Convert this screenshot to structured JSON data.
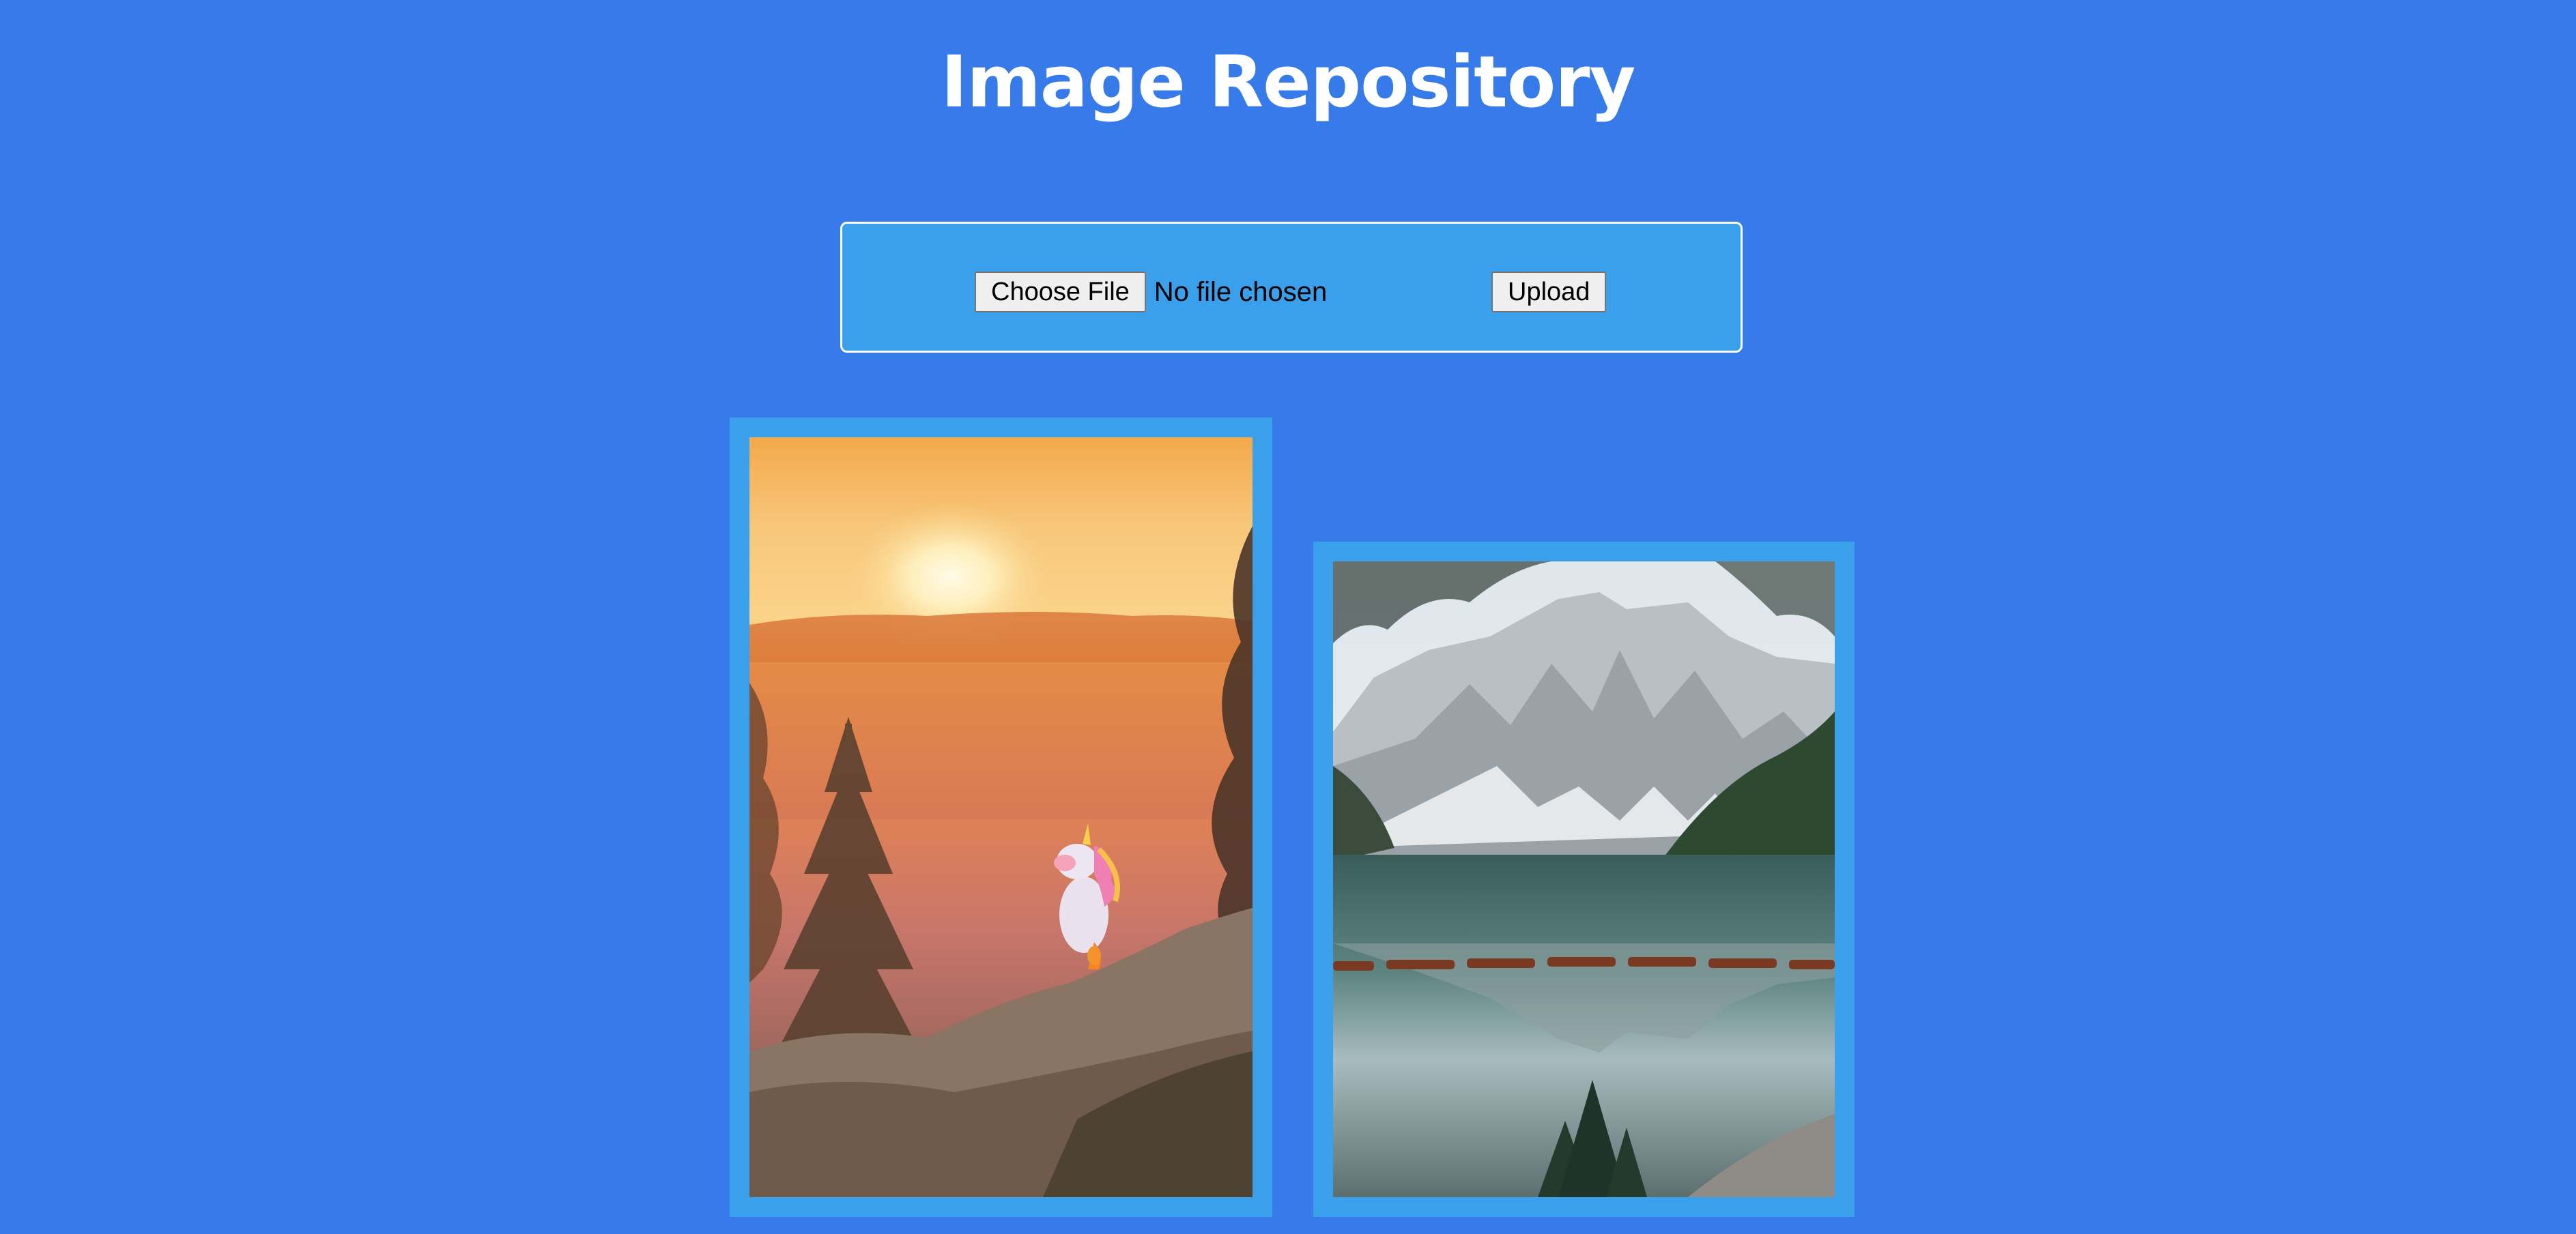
{
  "header": {
    "title": "Image Repository"
  },
  "upload_form": {
    "choose_file_label": "Choose File",
    "file_status": "No file chosen",
    "upload_label": "Upload"
  },
  "gallery": {
    "images": [
      {
        "subject": "sunset-forest-unicorn-figure"
      },
      {
        "subject": "mountain-lake-reflection"
      }
    ]
  },
  "colors": {
    "page_background": "#377beb",
    "panel_background": "#3aa0ec",
    "panel_border": "#ffffff",
    "title_text": "#ffffff"
  }
}
